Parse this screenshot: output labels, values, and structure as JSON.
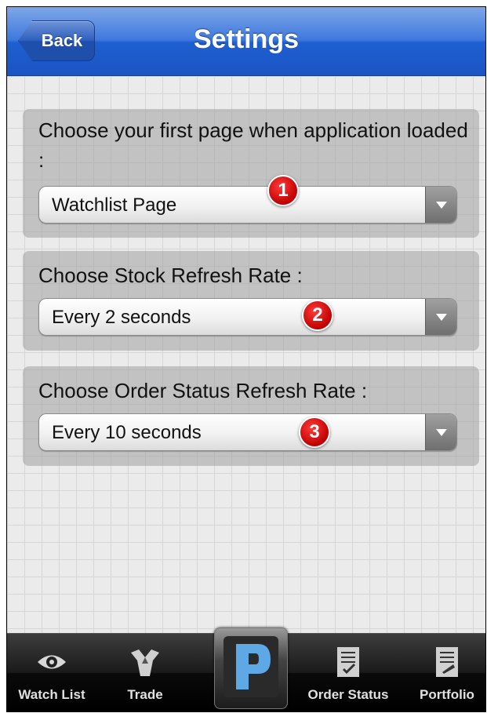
{
  "nav": {
    "back_label": "Back",
    "title": "Settings"
  },
  "settings": [
    {
      "label": "Choose your first page when application loaded :",
      "value": "Watchlist Page",
      "badge": "1"
    },
    {
      "label": "Choose Stock Refresh Rate :",
      "value": "Every 2 seconds",
      "badge": "2"
    },
    {
      "label": "Choose Order Status Refresh Rate :",
      "value": "Every 10 seconds",
      "badge": "3"
    }
  ],
  "tabbar": {
    "tabs": [
      {
        "label": "Watch List",
        "icon": "eye-icon"
      },
      {
        "label": "Trade",
        "icon": "trade-icon"
      },
      {
        "label": "",
        "icon": "p-logo-icon"
      },
      {
        "label": "Order Status",
        "icon": "order-status-icon"
      },
      {
        "label": "Portfolio",
        "icon": "portfolio-icon"
      }
    ]
  },
  "colors": {
    "nav_blue": "#1f5fd0",
    "badge_red": "#d10000",
    "tab_bar": "#111111"
  }
}
